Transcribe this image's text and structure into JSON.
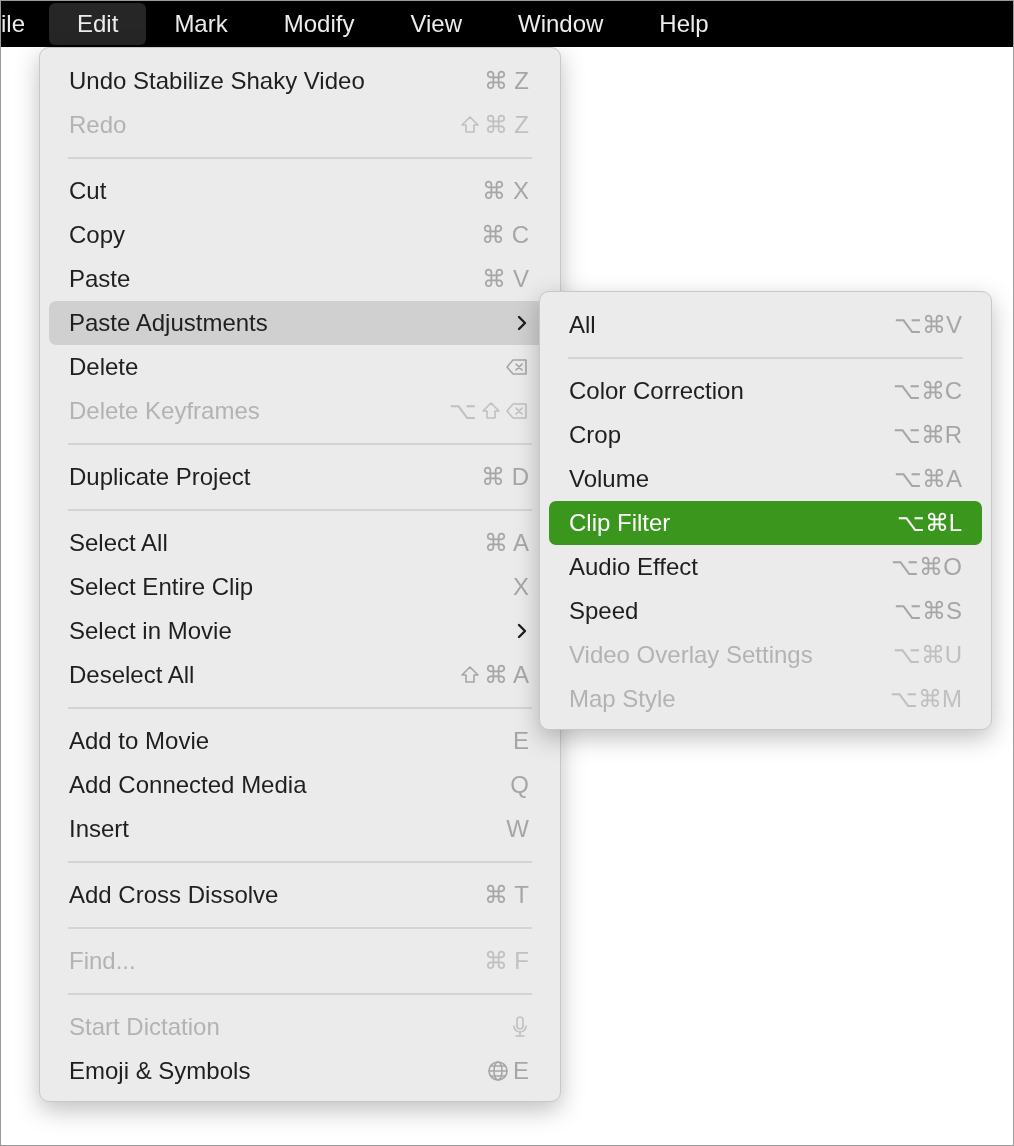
{
  "menu_bar": [
    {
      "label": "ile",
      "selected": false
    },
    {
      "label": "Edit",
      "selected": true
    },
    {
      "label": "Mark",
      "selected": false
    },
    {
      "label": "Modify",
      "selected": false
    },
    {
      "label": "View",
      "selected": false
    },
    {
      "label": "Window",
      "selected": false
    },
    {
      "label": "Help",
      "selected": false
    }
  ],
  "edit_menu": [
    {
      "kind": "item",
      "label": "Undo Stabilize Shaky Video",
      "shortcut": [
        {
          "kind": "text",
          "text": "⌘ Z"
        }
      ],
      "disabled": false,
      "selected": false
    },
    {
      "kind": "item",
      "label": "Redo",
      "shortcut": [
        {
          "kind": "shift"
        },
        {
          "kind": "text",
          "text": "⌘ Z"
        }
      ],
      "disabled": true,
      "selected": false
    },
    {
      "kind": "separator"
    },
    {
      "kind": "item",
      "label": "Cut",
      "shortcut": [
        {
          "kind": "text",
          "text": "⌘ X"
        }
      ],
      "disabled": false,
      "selected": false
    },
    {
      "kind": "item",
      "label": "Copy",
      "shortcut": [
        {
          "kind": "text",
          "text": "⌘ C"
        }
      ],
      "disabled": false,
      "selected": false
    },
    {
      "kind": "item",
      "label": "Paste",
      "shortcut": [
        {
          "kind": "text",
          "text": "⌘ V"
        }
      ],
      "disabled": false,
      "selected": false
    },
    {
      "kind": "submenu",
      "label": "Paste Adjustments",
      "disabled": false,
      "selected": true
    },
    {
      "kind": "item",
      "label": "Delete",
      "shortcut": [
        {
          "kind": "delete"
        }
      ],
      "disabled": false,
      "selected": false
    },
    {
      "kind": "item",
      "label": "Delete Keyframes",
      "shortcut": [
        {
          "kind": "text",
          "text": "⌥"
        },
        {
          "kind": "shift"
        },
        {
          "kind": "delete"
        }
      ],
      "disabled": true,
      "selected": false
    },
    {
      "kind": "separator"
    },
    {
      "kind": "item",
      "label": "Duplicate Project",
      "shortcut": [
        {
          "kind": "text",
          "text": "⌘ D"
        }
      ],
      "disabled": false,
      "selected": false
    },
    {
      "kind": "separator"
    },
    {
      "kind": "item",
      "label": "Select All",
      "shortcut": [
        {
          "kind": "text",
          "text": "⌘ A"
        }
      ],
      "disabled": false,
      "selected": false
    },
    {
      "kind": "item",
      "label": "Select Entire Clip",
      "shortcut": [
        {
          "kind": "text",
          "text": "X"
        }
      ],
      "disabled": false,
      "selected": false
    },
    {
      "kind": "submenu",
      "label": "Select in Movie",
      "disabled": false,
      "selected": false
    },
    {
      "kind": "item",
      "label": "Deselect All",
      "shortcut": [
        {
          "kind": "shift"
        },
        {
          "kind": "text",
          "text": "⌘ A"
        }
      ],
      "disabled": false,
      "selected": false
    },
    {
      "kind": "separator"
    },
    {
      "kind": "item",
      "label": "Add to Movie",
      "shortcut": [
        {
          "kind": "text",
          "text": "E"
        }
      ],
      "disabled": false,
      "selected": false
    },
    {
      "kind": "item",
      "label": "Add Connected Media",
      "shortcut": [
        {
          "kind": "text",
          "text": "Q"
        }
      ],
      "disabled": false,
      "selected": false
    },
    {
      "kind": "item",
      "label": "Insert",
      "shortcut": [
        {
          "kind": "text",
          "text": "W"
        }
      ],
      "disabled": false,
      "selected": false
    },
    {
      "kind": "separator"
    },
    {
      "kind": "item",
      "label": "Add Cross Dissolve",
      "shortcut": [
        {
          "kind": "text",
          "text": "⌘ T"
        }
      ],
      "disabled": false,
      "selected": false
    },
    {
      "kind": "separator"
    },
    {
      "kind": "item",
      "label": "Find...",
      "shortcut": [
        {
          "kind": "text",
          "text": "⌘ F"
        }
      ],
      "disabled": true,
      "selected": false
    },
    {
      "kind": "separator"
    },
    {
      "kind": "item",
      "label": "Start Dictation",
      "shortcut": [
        {
          "kind": "microphone"
        }
      ],
      "disabled": true,
      "selected": false
    },
    {
      "kind": "item",
      "label": "Emoji & Symbols",
      "shortcut": [
        {
          "kind": "globe"
        },
        {
          "kind": "text",
          "text": "E"
        }
      ],
      "disabled": false,
      "selected": false
    }
  ],
  "paste_adjustments_submenu": [
    {
      "kind": "item",
      "label": "All",
      "shortcut": [
        {
          "kind": "text",
          "text": "⌥⌘V"
        }
      ],
      "disabled": false,
      "selected": false
    },
    {
      "kind": "separator"
    },
    {
      "kind": "item",
      "label": "Color Correction",
      "shortcut": [
        {
          "kind": "text",
          "text": "⌥⌘C"
        }
      ],
      "disabled": false,
      "selected": false
    },
    {
      "kind": "item",
      "label": "Crop",
      "shortcut": [
        {
          "kind": "text",
          "text": "⌥⌘R"
        }
      ],
      "disabled": false,
      "selected": false
    },
    {
      "kind": "item",
      "label": "Volume",
      "shortcut": [
        {
          "kind": "text",
          "text": "⌥⌘A"
        }
      ],
      "disabled": false,
      "selected": false
    },
    {
      "kind": "item",
      "label": "Clip Filter",
      "shortcut": [
        {
          "kind": "text",
          "text": "⌥⌘L"
        }
      ],
      "disabled": false,
      "selected": true
    },
    {
      "kind": "item",
      "label": "Audio Effect",
      "shortcut": [
        {
          "kind": "text",
          "text": "⌥⌘O"
        }
      ],
      "disabled": false,
      "selected": false
    },
    {
      "kind": "item",
      "label": "Speed",
      "shortcut": [
        {
          "kind": "text",
          "text": "⌥⌘S"
        }
      ],
      "disabled": false,
      "selected": false
    },
    {
      "kind": "item",
      "label": "Video Overlay Settings",
      "shortcut": [
        {
          "kind": "text",
          "text": "⌥⌘U"
        }
      ],
      "disabled": true,
      "selected": false
    },
    {
      "kind": "item",
      "label": "Map Style",
      "shortcut": [
        {
          "kind": "text",
          "text": "⌥⌘M"
        }
      ],
      "disabled": true,
      "selected": false
    }
  ]
}
